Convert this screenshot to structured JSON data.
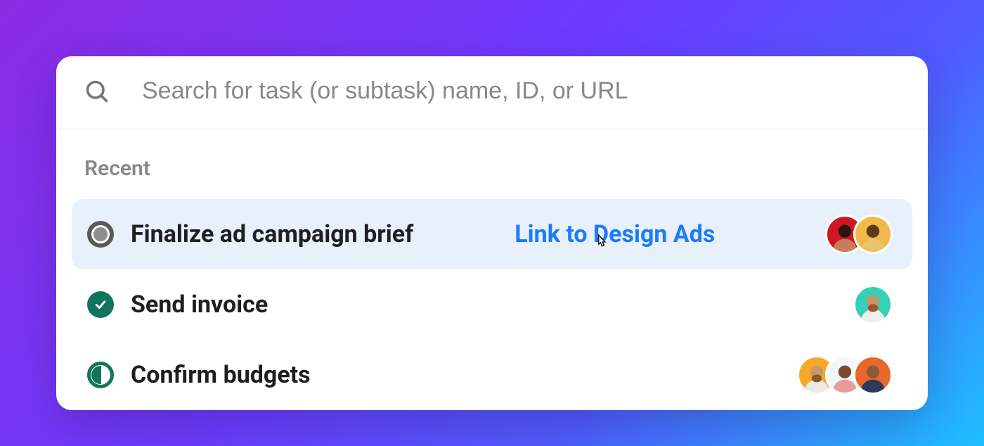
{
  "search": {
    "placeholder": "Search for task (or subtask) name, ID, or URL",
    "value": ""
  },
  "section": {
    "title": "Recent"
  },
  "tasks": [
    {
      "name": "Finalize ad campaign brief",
      "status": "todo",
      "link_label": "Link to Design Ads",
      "highlighted": true,
      "assignees": [
        {
          "bg": "bg-red"
        },
        {
          "bg": "bg-yellow"
        }
      ]
    },
    {
      "name": "Send invoice",
      "status": "done",
      "highlighted": false,
      "assignees": [
        {
          "bg": "bg-teal"
        }
      ]
    },
    {
      "name": "Confirm budgets",
      "status": "partial",
      "highlighted": false,
      "assignees": [
        {
          "bg": "bg-amber"
        },
        {
          "bg": "bg-blue"
        },
        {
          "bg": "bg-orange"
        }
      ]
    }
  ]
}
